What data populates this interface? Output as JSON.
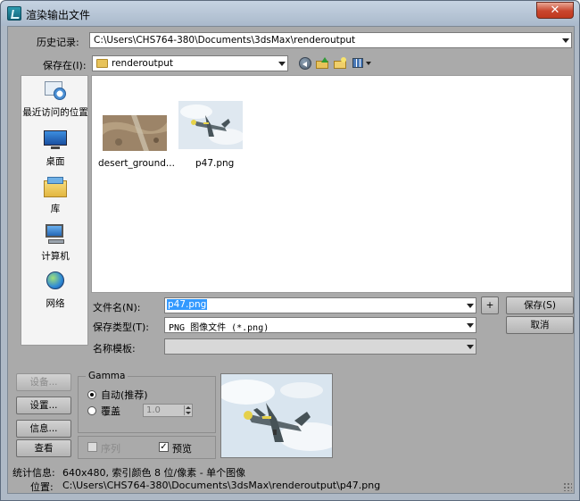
{
  "window": {
    "title": "渲染输出文件",
    "close_glyph": "✕"
  },
  "history": {
    "label": "历史记录:",
    "value": "C:\\Users\\CHS764-380\\Documents\\3dsMax\\renderoutput"
  },
  "save_in": {
    "label": "保存在(I):",
    "value": "renderoutput"
  },
  "toolbar_icons": [
    "back-icon",
    "up-folder-icon",
    "new-folder-icon",
    "view-menu-icon"
  ],
  "places": [
    {
      "label": "最近访问的位置",
      "icon": "recent-places-icon"
    },
    {
      "label": "桌面",
      "icon": "desktop-icon"
    },
    {
      "label": "库",
      "icon": "libraries-icon"
    },
    {
      "label": "计算机",
      "icon": "computer-icon"
    },
    {
      "label": "网络",
      "icon": "network-icon"
    }
  ],
  "files": [
    {
      "name": "desert_ground...",
      "thumb": "desert-ground-thumbnail"
    },
    {
      "name": "p47.png",
      "thumb": "p47-plane-thumbnail"
    }
  ],
  "filename": {
    "label": "文件名(N):",
    "value": "p47.png"
  },
  "filetype": {
    "label": "保存类型(T):",
    "value": "PNG 图像文件 (*.png)"
  },
  "template": {
    "label": "名称模板:",
    "value": ""
  },
  "buttons": {
    "plus": "+",
    "save": "保存(S)",
    "cancel": "取消",
    "setup_disabled": "设备...",
    "setup": "设置...",
    "info": "信息...",
    "view": "查看"
  },
  "gamma": {
    "title": "Gamma",
    "auto_label": "自动(推荐)",
    "override_label": "覆盖",
    "override_value": "1.0",
    "selected": "auto"
  },
  "options": {
    "sequence_label": "序列",
    "sequence_checked": false,
    "preview_label": "预览",
    "preview_checked": true,
    "check_glyph": "✓"
  },
  "status": {
    "stats_label": "统计信息:",
    "stats_value": "640x480, 索引颜色 8 位/像素 - 单个图像",
    "location_label": "位置:",
    "location_value": "C:\\Users\\CHS764-380\\Documents\\3dsMax\\renderoutput\\p47.png"
  },
  "colors": {
    "client_bg": "#aaaaaa",
    "selection": "#3399ff",
    "close_red": "#c8452d"
  }
}
